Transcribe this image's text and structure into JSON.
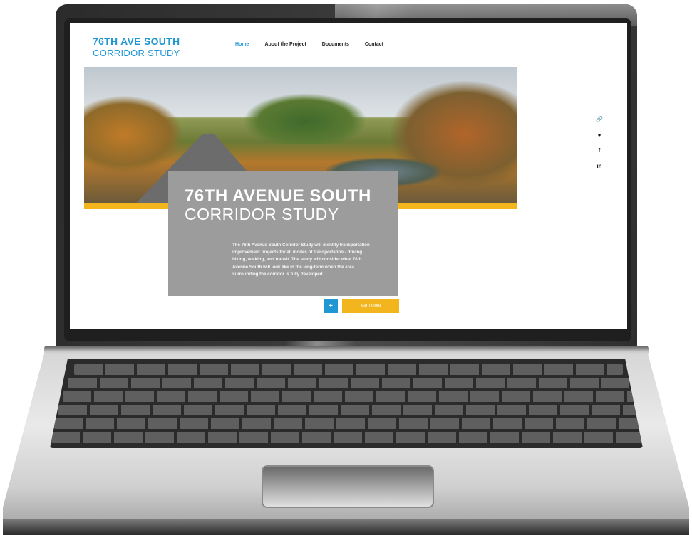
{
  "site": {
    "logo_line1": "76TH AVE SOUTH",
    "logo_line2": "CORRIDOR STUDY",
    "nav": [
      {
        "label": "Home",
        "active": true
      },
      {
        "label": "About the Project",
        "active": false
      },
      {
        "label": "Documents",
        "active": false
      },
      {
        "label": "Contact",
        "active": false
      }
    ],
    "hero": {
      "title_line1": "76TH AVENUE SOUTH",
      "title_line2": "CORRIDOR STUDY",
      "description": "The 76th Avenue South Corridor Study will identify transportation improvement projects for all modes of transportation - driving, biking, walking, and transit. The study will consider what 76th Avenue South will look like in the long-term when the area surrounding the corridor is fully developed.",
      "plus_label": "+",
      "cta_label": "learn more"
    },
    "social": [
      {
        "icon": "link-icon",
        "glyph": "🔗"
      },
      {
        "icon": "location-pin-icon",
        "glyph": "●"
      },
      {
        "icon": "facebook-icon",
        "glyph": "f"
      },
      {
        "icon": "linkedin-icon",
        "glyph": "in"
      }
    ]
  },
  "colors": {
    "brand_blue": "#1f97d4",
    "accent_yellow": "#f2b51e",
    "card_gray": "#9c9c9c"
  }
}
